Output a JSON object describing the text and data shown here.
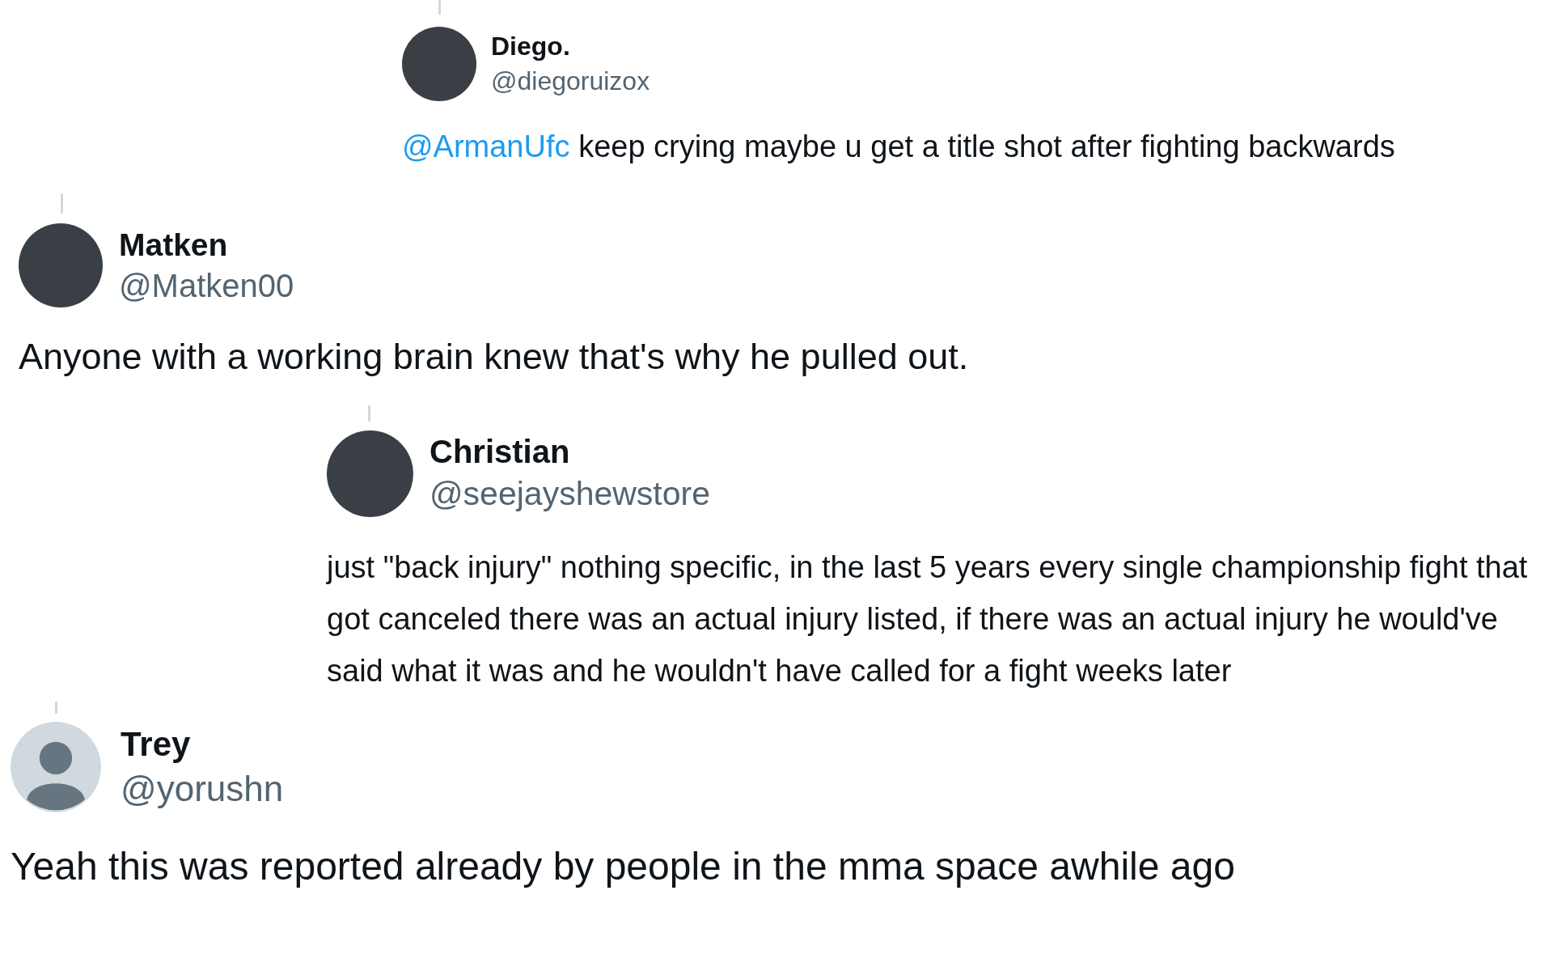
{
  "replies": [
    {
      "name": "Diego.",
      "handle": "@diegoruizox",
      "kind": "photo",
      "mention": "@ArmanUfc",
      "text": "keep crying maybe u get a title shot after fighting backwards"
    },
    {
      "name": "Matken",
      "handle": "@Matken00",
      "kind": "photo",
      "text": "Anyone with a working brain knew that's why he pulled out."
    },
    {
      "name": "Christian",
      "handle": "@seejayshewstore",
      "kind": "photo",
      "text": "just \"back injury\" nothing specific, in the last 5 years every single championship fight that got canceled there was an actual injury listed, if there was an actual injury he would've said what it was and he wouldn't have called for a fight weeks later"
    },
    {
      "name": "Trey",
      "handle": "@yorushn",
      "kind": "default",
      "text": "Yeah this was reported already by people in the mma space awhile ago"
    }
  ]
}
